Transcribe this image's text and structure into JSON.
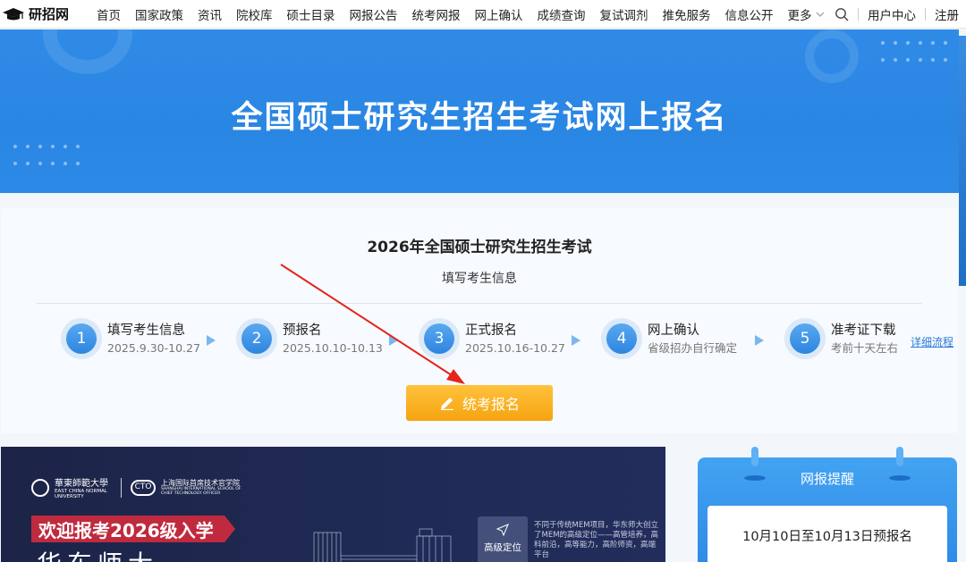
{
  "site": {
    "logo_text": "研招网"
  },
  "nav": {
    "items": [
      "首页",
      "国家政策",
      "资讯",
      "院校库",
      "硕士目录",
      "网报公告",
      "统考网报",
      "网上确认",
      "成绩查询",
      "复试调剂",
      "推免服务",
      "信息公开"
    ],
    "more_label": "更多",
    "user_center": "用户中心",
    "register": "注册"
  },
  "hero": {
    "title": "全国硕士研究生招生考试网上报名"
  },
  "card": {
    "title": "2026年全国硕士研究生招生考试",
    "subtitle": "填写考生信息",
    "steps": [
      {
        "num": "1",
        "name": "填写考生信息",
        "date": "2025.9.30-10.27"
      },
      {
        "num": "2",
        "name": "预报名",
        "date": "2025.10.10-10.13"
      },
      {
        "num": "3",
        "name": "正式报名",
        "date": "2025.10.16-10.27"
      },
      {
        "num": "4",
        "name": "网上确认",
        "date": "省级招办自行确定"
      },
      {
        "num": "5",
        "name": "准考证下载",
        "date": "考前十天左右"
      }
    ],
    "detail_link": "详细流程",
    "apply_button": "统考报名"
  },
  "ad": {
    "school_name": "華東師範大學",
    "school_en": "EAST CHINA NORMAL UNIVERSITY",
    "cto_badge": "CTO",
    "institute_name": "上海国际首席技术官学院",
    "institute_en": "SHANGHAI INTERNATIONAL SCHOOL OF CHIEF TECHNOLOGY OFFICER",
    "welcome": "欢迎报考2026级入学",
    "big_text": "华东师大",
    "feature_label": "高级定位",
    "feature_desc": "不同于传统MEM项目，华东师大创立了MEM的高级定位——高管培养，高科前沿，高等能力，高阶师资，高端平台"
  },
  "remind": {
    "title": "网报提醒",
    "body": "10月10日至10月13日预报名"
  },
  "colors": {
    "hero_blue": "#2a86e3",
    "apply_orange": "#f5a40f",
    "step_blue": "#2d85e0",
    "annotation_red": "#e5241b"
  }
}
